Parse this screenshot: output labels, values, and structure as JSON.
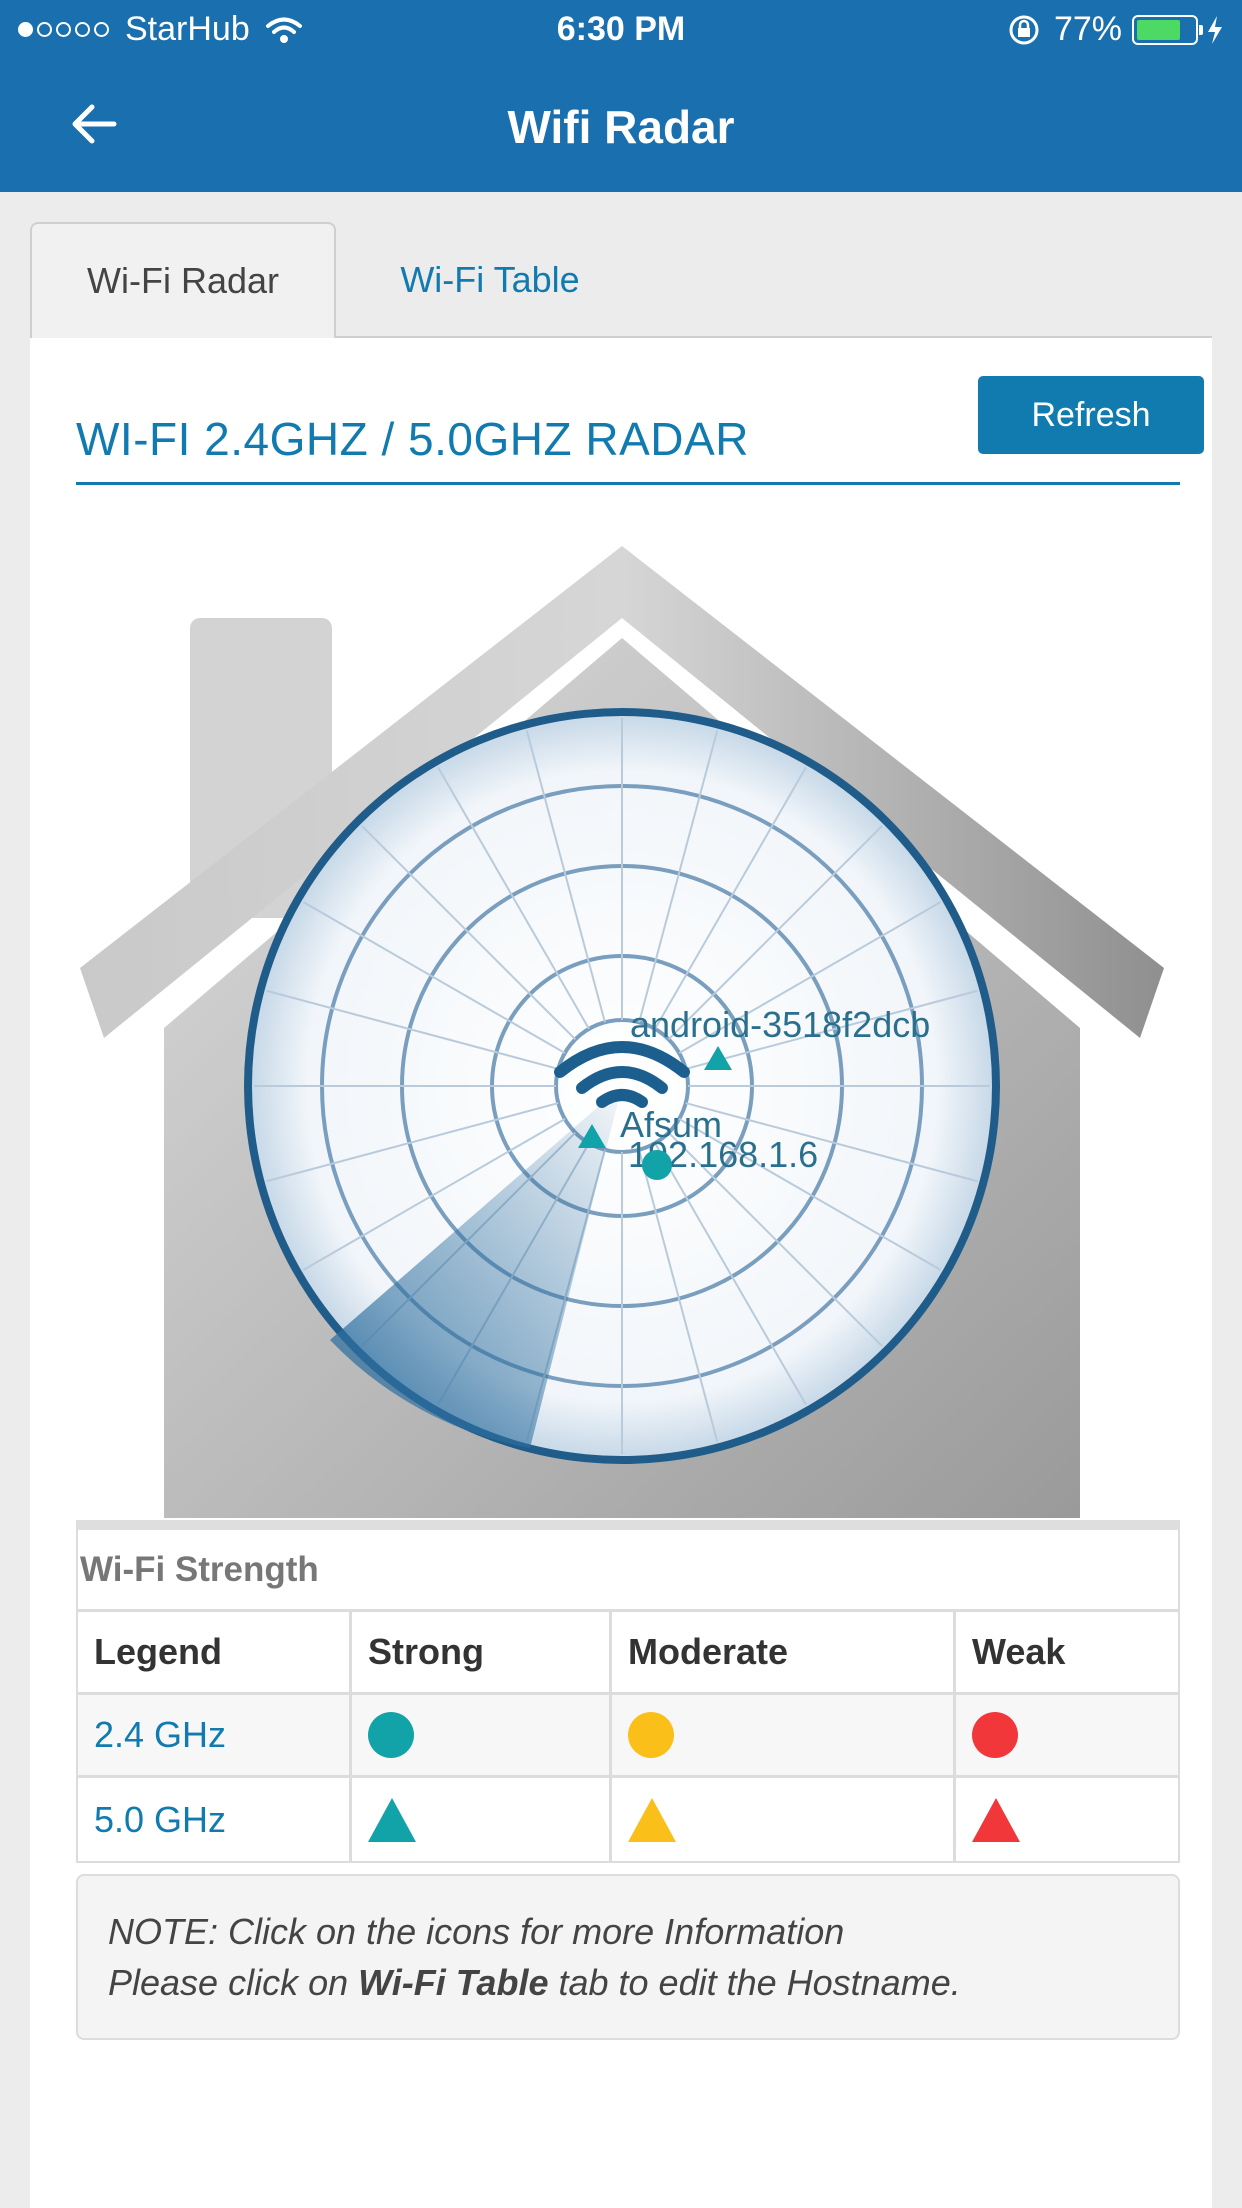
{
  "status_bar": {
    "carrier": "StarHub",
    "time": "6:30 PM",
    "battery_percent": "77%",
    "battery_level": 0.77,
    "signal_dots_filled": 1,
    "signal_dots_total": 5
  },
  "header": {
    "title": "Wifi Radar",
    "background_color": "#1a6fae"
  },
  "tabs": [
    {
      "label": "Wi-Fi Radar",
      "active": true
    },
    {
      "label": "Wi-Fi Table",
      "active": false
    }
  ],
  "radar_section": {
    "title": "WI-FI 2.4GHZ / 5.0GHZ RADAR",
    "refresh_label": "Refresh"
  },
  "devices": [
    {
      "label": "android-3518f2dcb",
      "band": "5.0 GHz",
      "strength": "Strong"
    },
    {
      "label": "Afsum",
      "band": "5.0 GHz",
      "strength": "Strong"
    },
    {
      "label": "192.168.1.6",
      "band": "2.4 GHz",
      "strength": "Strong"
    }
  ],
  "legend": {
    "title": "Wi-Fi Strength",
    "headers": [
      "Legend",
      "Strong",
      "Moderate",
      "Weak"
    ],
    "rows": [
      {
        "band": "2.4 GHz",
        "symbol": "circle"
      },
      {
        "band": "5.0 GHz",
        "symbol": "triangle"
      }
    ],
    "colors": {
      "strong": "#12a3a8",
      "moderate": "#fbbf1a",
      "weak": "#f2373a"
    }
  },
  "note": {
    "line1": "NOTE: Click on the icons for more Information",
    "line2_prefix": "Please click on ",
    "line2_bold": "Wi-Fi Table",
    "line2_suffix": " tab to edit the Hostname."
  },
  "accent_color": "#117bb0"
}
